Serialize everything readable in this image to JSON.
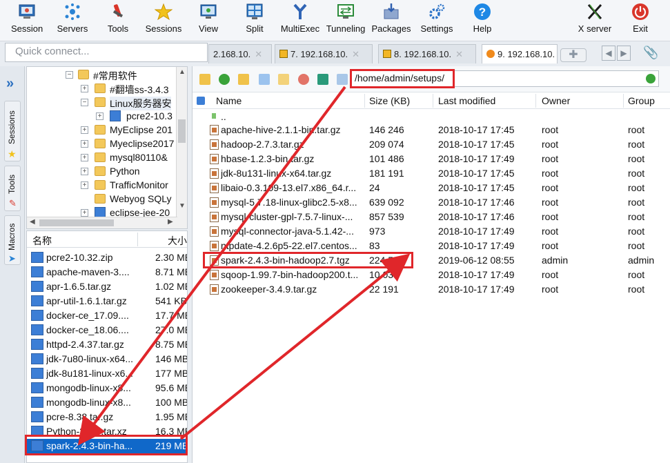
{
  "toolbar": {
    "buttons": [
      {
        "label": "Session",
        "icon": "session-icon"
      },
      {
        "label": "Servers",
        "icon": "servers-icon"
      },
      {
        "label": "Tools",
        "icon": "tools-icon"
      },
      {
        "label": "Sessions",
        "icon": "star-icon"
      },
      {
        "label": "View",
        "icon": "view-icon"
      },
      {
        "label": "Split",
        "icon": "split-icon"
      },
      {
        "label": "MultiExec",
        "icon": "multiexec-icon"
      },
      {
        "label": "Tunneling",
        "icon": "tunneling-icon"
      },
      {
        "label": "Packages",
        "icon": "packages-icon"
      },
      {
        "label": "Settings",
        "icon": "settings-icon"
      },
      {
        "label": "Help",
        "icon": "help-icon"
      },
      {
        "label": "X server",
        "icon": "xserver-icon"
      },
      {
        "label": "Exit",
        "icon": "exit-icon"
      }
    ]
  },
  "quick_connect": {
    "placeholder": "Quick connect..."
  },
  "tabs": [
    {
      "label": "2.168.10."
    },
    {
      "label": "7. 192.168.10."
    },
    {
      "label": "8. 192.168.10."
    },
    {
      "label": "9. 192.168.10."
    }
  ],
  "sidebar": {
    "sessions": "Sessions",
    "tools": "Tools",
    "macros": "Macros"
  },
  "tree": {
    "items": [
      {
        "label": "#常用软件"
      },
      {
        "label": "#翻墙ss-3.4.3"
      },
      {
        "label": "Linux服务器安"
      },
      {
        "label": "pcre2-10.3"
      },
      {
        "label": "MyEclipse 201"
      },
      {
        "label": "Myeclipse2017"
      },
      {
        "label": "mysql80110&"
      },
      {
        "label": "Python"
      },
      {
        "label": "TrafficMonitor"
      },
      {
        "label": "Webyog SQLy"
      },
      {
        "label": "eclipse-jee-20"
      }
    ]
  },
  "local_files": {
    "header": {
      "name": "名称",
      "size": "大小"
    },
    "rows": [
      {
        "name": "pcre2-10.32.zip",
        "size": "2.30 MB"
      },
      {
        "name": "apache-maven-3....",
        "size": "8.71 MB"
      },
      {
        "name": "apr-1.6.5.tar.gz",
        "size": "1.02 MB"
      },
      {
        "name": "apr-util-1.6.1.tar.gz",
        "size": "541 KB"
      },
      {
        "name": "docker-ce_17.09....",
        "size": "17.7 MB"
      },
      {
        "name": "docker-ce_18.06....",
        "size": "27.0 MB"
      },
      {
        "name": "httpd-2.4.37.tar.gz",
        "size": "8.75 MB"
      },
      {
        "name": "jdk-7u80-linux-x64...",
        "size": "146 MB"
      },
      {
        "name": "jdk-8u181-linux-x6...",
        "size": "177 MB"
      },
      {
        "name": "mongodb-linux-x8...",
        "size": "95.6 MB"
      },
      {
        "name": "mongodb-linux-x8...",
        "size": "100 MB"
      },
      {
        "name": "pcre-8.38.tar.gz",
        "size": "1.95 MB"
      },
      {
        "name": "Python-3.7.3.tar.xz",
        "size": "16.3 MB"
      },
      {
        "name": "spark-2.4.3-bin-ha...",
        "size": "219 MB"
      }
    ]
  },
  "remote": {
    "path": "/home/admin/setups/",
    "header": {
      "name": "Name",
      "size": "Size (KB)",
      "modified": "Last modified",
      "owner": "Owner",
      "group": "Group"
    },
    "rows": [
      {
        "name": "..",
        "size": "",
        "modified": "",
        "owner": "",
        "group": ""
      },
      {
        "name": "apache-hive-2.1.1-bin.tar.gz",
        "size": "146 246",
        "modified": "2018-10-17 17:45",
        "owner": "root",
        "group": "root"
      },
      {
        "name": "hadoop-2.7.3.tar.gz",
        "size": "209 074",
        "modified": "2018-10-17 17:45",
        "owner": "root",
        "group": "root"
      },
      {
        "name": "hbase-1.2.3-bin.tar.gz",
        "size": "101 486",
        "modified": "2018-10-17 17:49",
        "owner": "root",
        "group": "root"
      },
      {
        "name": "jdk-8u131-linux-x64.tar.gz",
        "size": "181 191",
        "modified": "2018-10-17 17:45",
        "owner": "root",
        "group": "root"
      },
      {
        "name": "libaio-0.3.109-13.el7.x86_64.r...",
        "size": "24",
        "modified": "2018-10-17 17:45",
        "owner": "root",
        "group": "root"
      },
      {
        "name": "mysql-5.7.18-linux-glibc2.5-x8...",
        "size": "639 092",
        "modified": "2018-10-17 17:46",
        "owner": "root",
        "group": "root"
      },
      {
        "name": "mysql-cluster-gpl-7.5.7-linux-...",
        "size": "857 539",
        "modified": "2018-10-17 17:46",
        "owner": "root",
        "group": "root"
      },
      {
        "name": "mysql-connector-java-5.1.42-...",
        "size": "973",
        "modified": "2018-10-17 17:49",
        "owner": "root",
        "group": "root"
      },
      {
        "name": "ntpdate-4.2.6p5-22.el7.centos...",
        "size": "83",
        "modified": "2018-10-17 17:49",
        "owner": "root",
        "group": "root"
      },
      {
        "name": "spark-2.4.3-bin-hadoop2.7.tgz",
        "size": "224 597",
        "modified": "2019-06-12 08:55",
        "owner": "admin",
        "group": "admin"
      },
      {
        "name": "sqoop-1.99.7-bin-hadoop200.t...",
        "size": "10 035",
        "modified": "2018-10-17 17:49",
        "owner": "root",
        "group": "root"
      },
      {
        "name": "zookeeper-3.4.9.tar.gz",
        "size": "22 191",
        "modified": "2018-10-17 17:49",
        "owner": "root",
        "group": "root"
      }
    ]
  },
  "colors": {
    "annotation": "#e0262a",
    "selection": "#1068c9"
  }
}
